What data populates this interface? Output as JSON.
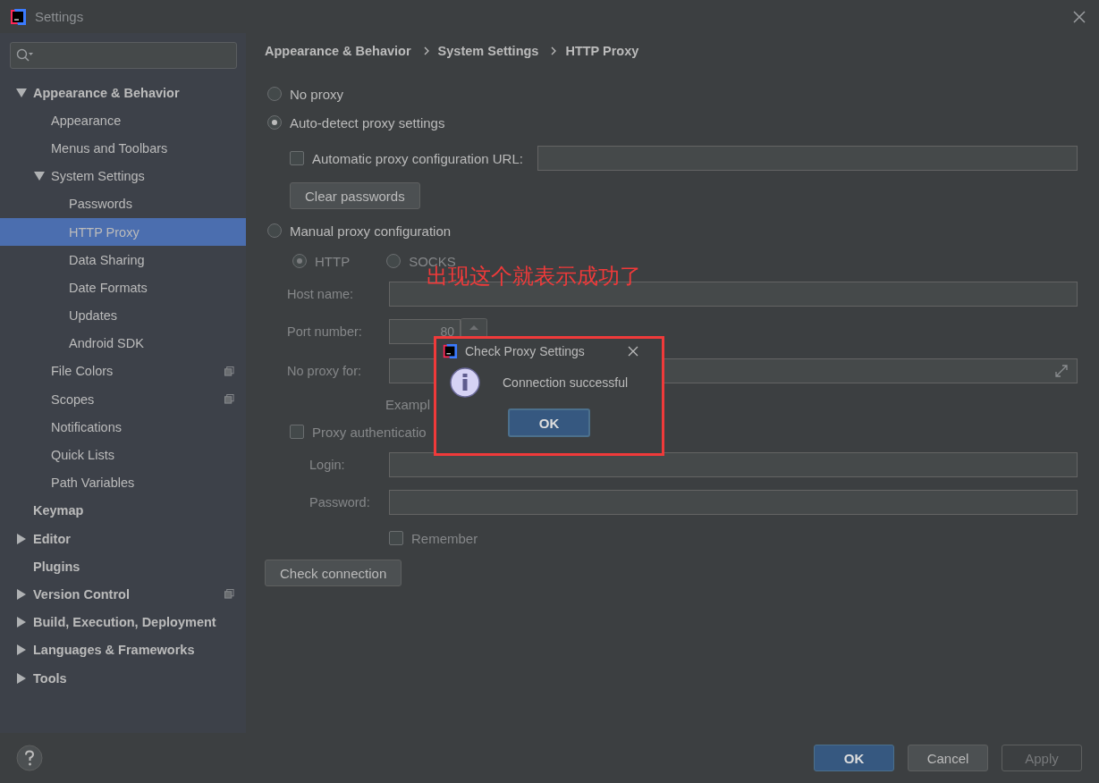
{
  "window": {
    "title": "Settings"
  },
  "sidebar": {
    "items": [
      {
        "label": "Appearance & Behavior",
        "expanded": true,
        "selected": false,
        "children": [
          {
            "label": "Appearance",
            "selected": false
          },
          {
            "label": "Menus and Toolbars",
            "selected": false
          },
          {
            "label": "System Settings",
            "expanded": true,
            "selected": false,
            "children": [
              {
                "label": "Passwords",
                "selected": false
              },
              {
                "label": "HTTP Proxy",
                "selected": true
              },
              {
                "label": "Data Sharing",
                "selected": false
              },
              {
                "label": "Date Formats",
                "selected": false
              },
              {
                "label": "Updates",
                "selected": false
              },
              {
                "label": "Android SDK",
                "selected": false
              }
            ]
          },
          {
            "label": "File Colors",
            "selected": false,
            "project_level": true
          },
          {
            "label": "Scopes",
            "selected": false,
            "project_level": true
          },
          {
            "label": "Notifications",
            "selected": false
          },
          {
            "label": "Quick Lists",
            "selected": false
          },
          {
            "label": "Path Variables",
            "selected": false
          }
        ]
      },
      {
        "label": "Keymap",
        "selected": false
      },
      {
        "label": "Editor",
        "expanded": false,
        "selected": false
      },
      {
        "label": "Plugins",
        "selected": false
      },
      {
        "label": "Version Control",
        "expanded": false,
        "selected": false,
        "project_level": true
      },
      {
        "label": "Build, Execution, Deployment",
        "expanded": false,
        "selected": false
      },
      {
        "label": "Languages & Frameworks",
        "expanded": false,
        "selected": false
      },
      {
        "label": "Tools",
        "expanded": false,
        "selected": false
      }
    ]
  },
  "breadcrumb": [
    "Appearance & Behavior",
    "System Settings",
    "HTTP Proxy"
  ],
  "proxy": {
    "modes": [
      {
        "label": "No proxy",
        "selected": false
      },
      {
        "label": "Auto-detect proxy settings",
        "selected": true
      },
      {
        "label": "Manual proxy configuration",
        "selected": false
      }
    ],
    "auto_config_url": {
      "label": "Automatic proxy configuration URL:",
      "checked": false
    },
    "clear_passwords_button": "Clear passwords",
    "manual": {
      "disabled": true,
      "protocols": [
        {
          "label": "HTTP",
          "selected": true
        },
        {
          "label": "SOCKS",
          "selected": false
        }
      ],
      "host_name": {
        "label": "Host name:"
      },
      "port_number": {
        "label": "Port number:",
        "value": "80"
      },
      "no_proxy_for": {
        "label": "No proxy for:"
      },
      "example": "Exampl",
      "proxy_authentication": {
        "label": "Proxy authenticatio",
        "checked": false
      },
      "login": {
        "label": "Login:"
      },
      "password": {
        "label": "Password:"
      },
      "remember": {
        "label": "Remember",
        "checked": false
      }
    },
    "check_connection_button": "Check connection"
  },
  "annotation": "出现这个就表示成功了",
  "dialog": {
    "title": "Check Proxy Settings",
    "message": "Connection successful",
    "button": "OK"
  },
  "footer": {
    "buttons": [
      {
        "label": "OK",
        "kind": "primary",
        "disabled": false
      },
      {
        "label": "Cancel",
        "kind": "normal",
        "disabled": false
      },
      {
        "label": "Apply",
        "kind": "normal",
        "disabled": true
      }
    ]
  }
}
